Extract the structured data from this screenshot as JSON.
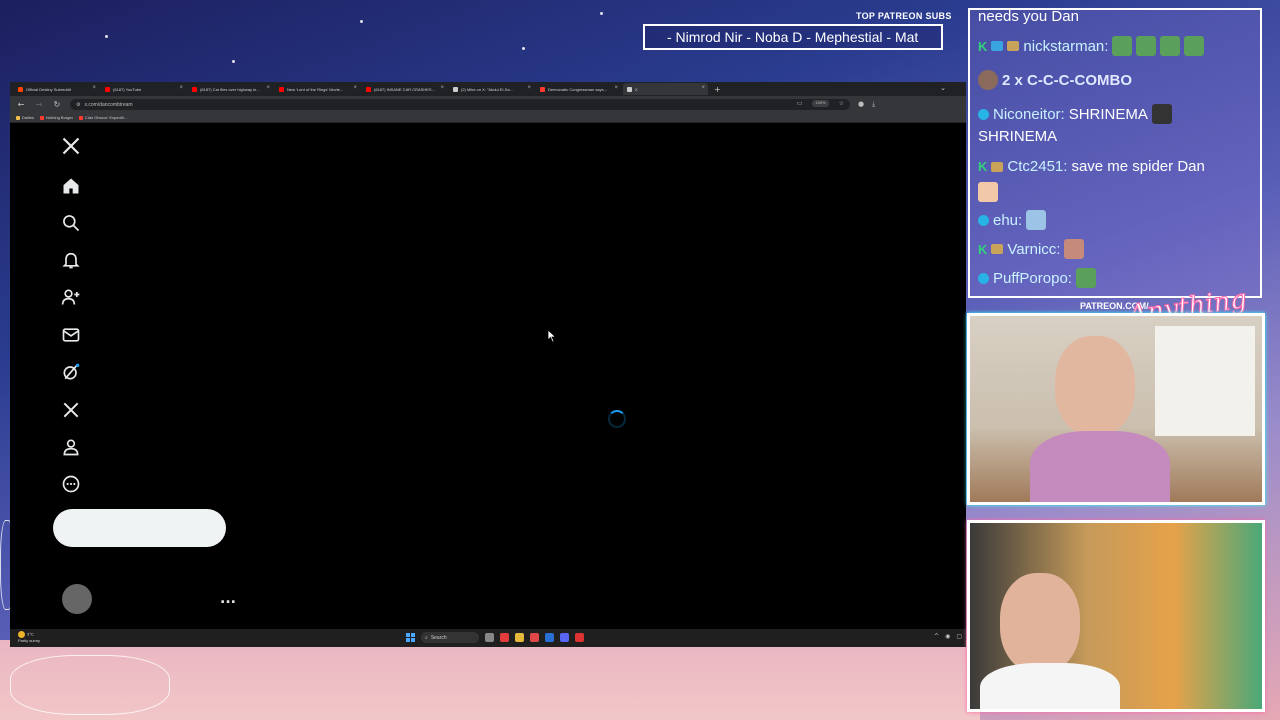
{
  "overlay": {
    "top_patreon_label": "TOP PATREON SUBS",
    "ticker_text": "- Nimrod Nir - Noba D - Mephestial - Mat",
    "patreon_url": "PATREON.COM/",
    "brand_script": "Anything Else"
  },
  "chat": {
    "messages": [
      {
        "user": "",
        "text": "needs you Dan"
      },
      {
        "user": "nickstarman:",
        "text": ""
      },
      {
        "user": "",
        "text": "2 x C-C-C-COMBO"
      },
      {
        "user": "Niconeitor:",
        "text": "SHRINEMA"
      },
      {
        "user": "",
        "text": "SHRINEMA"
      },
      {
        "user": "Ctc2451:",
        "text": "save me spider Dan"
      },
      {
        "user": "ehu:",
        "text": ""
      },
      {
        "user": "Varnicc:",
        "text": ""
      },
      {
        "user": "PuffPoropo:",
        "text": ""
      }
    ]
  },
  "browser": {
    "tabs": [
      {
        "label": "Official Destiny Subreddit",
        "color": "#ff4500"
      },
      {
        "label": "(6187) YouTube",
        "color": "#ff0000"
      },
      {
        "label": "(6187) Car flies over highway in...",
        "color": "#ff0000"
      },
      {
        "label": "New 'Lord of the Rings' Movie...",
        "color": "#ff0000"
      },
      {
        "label": "(6187) INSANE CAR CRASHES...",
        "color": "#ff0000"
      },
      {
        "label": "(2) Mike on X: \"Abdul El-Sa...",
        "color": "#cccccc"
      },
      {
        "label": "Democratic Congressman says...",
        "color": "#ff3b30"
      },
      {
        "label": "X",
        "color": "#cccccc"
      }
    ],
    "new_tab": "+",
    "url": "x.com/dancombtream",
    "zoom": "150%",
    "bookmarks": [
      {
        "label": "Dailies",
        "color": "#f0c04a"
      },
      {
        "label": "Nothing Burger",
        "color": "#ff3b30"
      },
      {
        "label": "Clair Obscur: Expediti...",
        "color": "#ff3b30"
      }
    ]
  },
  "x_page": {
    "nav_icons": [
      "x-logo-icon",
      "home-icon",
      "search-icon",
      "notifications-icon",
      "follow-icon",
      "messages-icon",
      "grok-icon",
      "premium-x-icon",
      "profile-icon",
      "more-circle-icon"
    ],
    "post_button": "",
    "more_label": "..."
  },
  "taskbar": {
    "weather_temp": "3°C",
    "weather_desc": "Partly sunny",
    "search_label": "Search"
  }
}
